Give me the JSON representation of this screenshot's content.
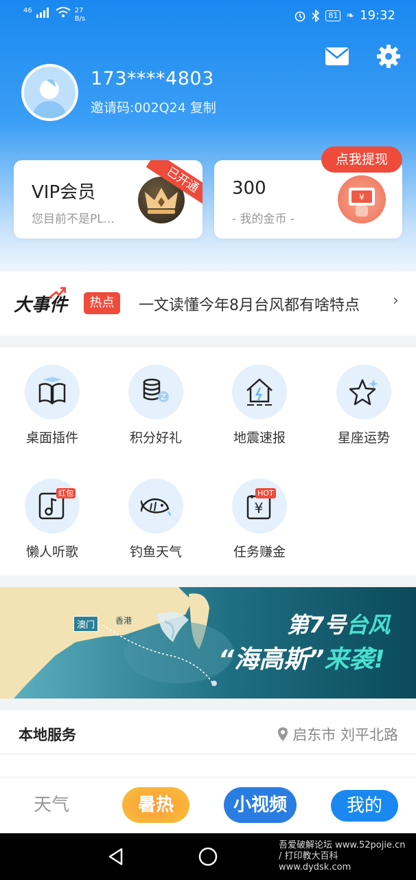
{
  "status_bar": {
    "signal_label": "46",
    "speed": "27 B/s",
    "battery": "81",
    "time": "19:32"
  },
  "profile": {
    "phone": "173****4803",
    "invite_text": "邀请码:002Q24 复制"
  },
  "cards": {
    "vip_title": "VIP会员",
    "vip_subtitle": "您目前不是PL...",
    "vip_ribbon": "已开通",
    "coins_value": "300",
    "coins_subtitle": "- 我的金币 -",
    "withdraw_label": "点我提现"
  },
  "news": {
    "brand": "大事件",
    "tag": "热点",
    "headline": "一文读懂今年8月台风都有啥特点",
    "chevron": "›"
  },
  "grid": {
    "items": [
      {
        "label": "桌面插件",
        "icon": "widget-icon"
      },
      {
        "label": "积分好礼",
        "icon": "coins-icon"
      },
      {
        "label": "地震速报",
        "icon": "house-quake-icon"
      },
      {
        "label": "星座运势",
        "icon": "star-icon"
      },
      {
        "label": "懒人听歌",
        "icon": "music-icon",
        "badge": "红包"
      },
      {
        "label": "钓鱼天气",
        "icon": "fish-icon"
      },
      {
        "label": "任务赚金",
        "icon": "task-icon",
        "badge": "HOT"
      }
    ]
  },
  "banner": {
    "city1": "澳门",
    "city2": "香港",
    "line1_prefix": "第",
    "line1_num": "7",
    "line1_mid": "号",
    "line1_highlight": "台风",
    "line2_name": "“海高斯”",
    "line2_suffix": "来袭!"
  },
  "local": {
    "title": "本地服务",
    "location": "启东市 刘平北路"
  },
  "tabbar": {
    "tabs": [
      "天气",
      "暑热",
      "小视频",
      "我的"
    ]
  },
  "watermark": "吾爱破解论坛 www.52pojie.cn / 打印教大百科 www.dydsk.com",
  "colors": {
    "primary_blue": "#1a88f0",
    "accent_red": "#ee4b3b",
    "icon_bg": "#e4f1fd"
  }
}
